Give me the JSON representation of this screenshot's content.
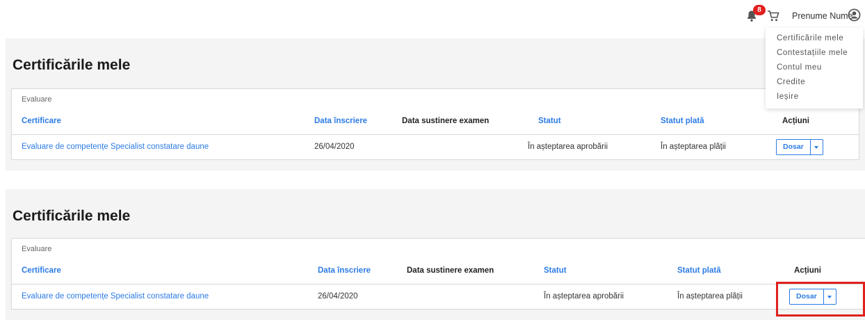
{
  "header": {
    "notification_count": "8",
    "user_name": "Prenume Nume"
  },
  "user_menu": {
    "items": [
      "Certificările mele",
      "Contestațiile mele",
      "Contul meu",
      "Credite",
      "Ieșire"
    ]
  },
  "sections": [
    {
      "title": "Certificările mele",
      "panel_label": "Evaluare",
      "columns": [
        "Certificare",
        "Data înscriere",
        "Data sustinere examen",
        "Statut",
        "Statut plată",
        "Acțiuni"
      ],
      "row": {
        "certificare": "Evaluare de competențe Specialist constatare daune",
        "data_inscriere": "26/04/2020",
        "data_sustinere": "",
        "statut": "În așteptarea aprobării",
        "statut_plata": "În așteptarea plății",
        "action_label": "Dosar"
      }
    },
    {
      "title": "Certificările mele",
      "panel_label": "Evaluare",
      "columns": [
        "Certificare",
        "Data înscriere",
        "Data sustinere examen",
        "Statut",
        "Statut plată",
        "Acțiuni"
      ],
      "row": {
        "certificare": "Evaluare de competențe Specialist constatare daune",
        "data_inscriere": "26/04/2020",
        "data_sustinere": "",
        "statut": "În așteptarea aprobării",
        "statut_plata": "În așteptarea plății",
        "action_label": "Dosar"
      }
    }
  ],
  "colors": {
    "accent": "#2c7be5",
    "badge": "#e0201f",
    "highlight": "#e0201f",
    "section_bg": "#f4f4f4"
  },
  "icons": {
    "notifications": "bell-icon",
    "cart": "cart-icon",
    "user": "user-circle-icon",
    "dropdown": "caret-down-icon"
  }
}
